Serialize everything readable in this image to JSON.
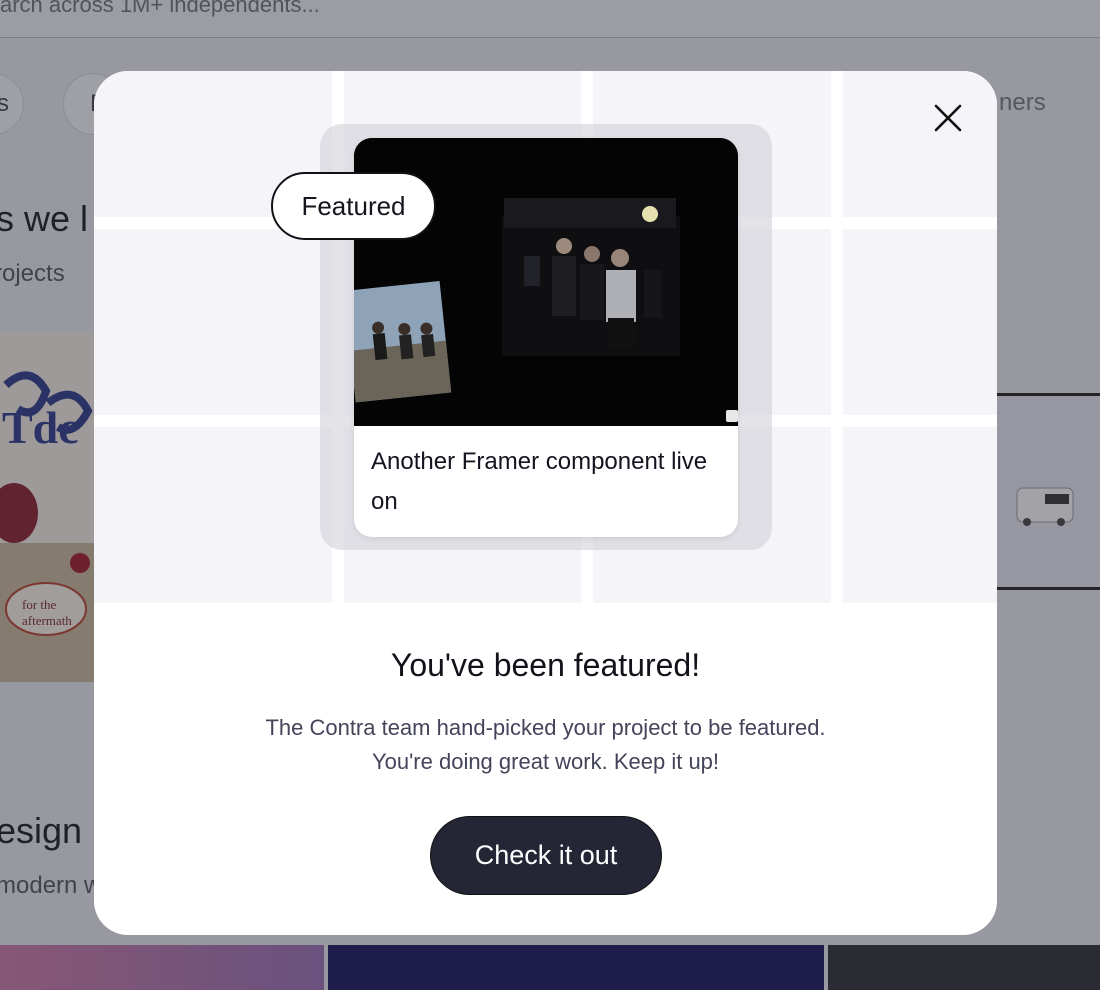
{
  "background_page": {
    "search_placeholder": "arch across 1M+ independents...",
    "filter_chip_left": "s",
    "filter_chip_second": "F",
    "filter_chip_right": "ners",
    "section_heading_top": "s we l",
    "section_sub_top": "rojects",
    "section_heading_bottom": "esign p",
    "section_sub_bottom": "modern w"
  },
  "modal": {
    "badge": "Featured",
    "project_card": {
      "title": "Another Framer component live on"
    },
    "title": "You've been featured!",
    "message_line1": "The Contra team hand-picked your project to be featured.",
    "message_line2": "You're doing great work. Keep it up!",
    "cta_label": "Check it out",
    "close_icon": "close-icon"
  },
  "colors": {
    "cta_background": "#242636",
    "modal_background": "#ffffff",
    "hero_background": "#f4f4f9",
    "overlay": "rgba(40,40,52,0.42)"
  }
}
